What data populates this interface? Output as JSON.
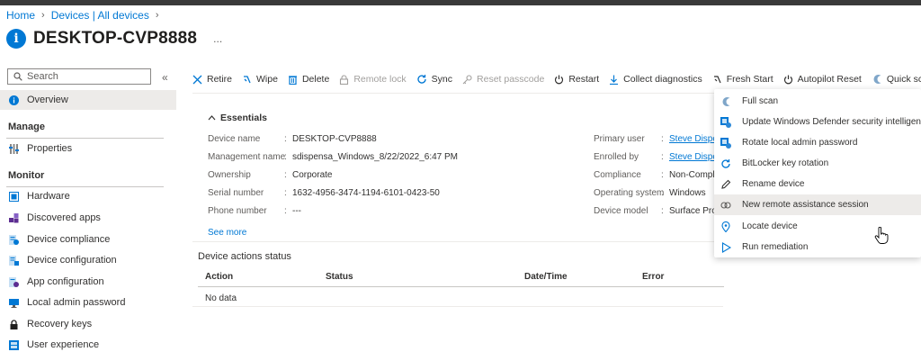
{
  "breadcrumb": {
    "home": "Home",
    "devices": "Devices | All devices"
  },
  "page": {
    "title": "DESKTOP-CVP8888",
    "more": "..."
  },
  "sidebar": {
    "search_placeholder": "Search",
    "collapse": "«",
    "overview": "Overview",
    "manage_heading": "Manage",
    "properties": "Properties",
    "monitor_heading": "Monitor",
    "monitor_items": [
      "Hardware",
      "Discovered apps",
      "Device compliance",
      "Device configuration",
      "App configuration",
      "Local admin password",
      "Recovery keys",
      "User experience"
    ]
  },
  "toolbar": {
    "retire": "Retire",
    "wipe": "Wipe",
    "delete": "Delete",
    "remote_lock": "Remote lock",
    "sync": "Sync",
    "reset_passcode": "Reset passcode",
    "restart": "Restart",
    "collect_diagnostics": "Collect diagnostics",
    "fresh_start": "Fresh Start",
    "autopilot_reset": "Autopilot Reset",
    "quick_scan": "Quick scan",
    "more": "..."
  },
  "essentials": {
    "heading": "Essentials",
    "left": [
      {
        "label": "Device name",
        "value": "DESKTOP-CVP8888"
      },
      {
        "label": "Management name",
        "value": "sdispensa_Windows_8/22/2022_6:47 PM"
      },
      {
        "label": "Ownership",
        "value": "Corporate"
      },
      {
        "label": "Serial number",
        "value": "1632-4956-3474-1194-6101-0423-50"
      },
      {
        "label": "Phone number",
        "value": "---"
      }
    ],
    "right": [
      {
        "label": "Primary user",
        "value": "Steve Dispen"
      },
      {
        "label": "Enrolled by",
        "value": "Steve Dispen"
      },
      {
        "label": "Compliance",
        "value": "Non-Compl"
      },
      {
        "label": "Operating system",
        "value": "Windows"
      },
      {
        "label": "Device model",
        "value": "Surface Pro"
      }
    ],
    "see_more": "See more"
  },
  "device_actions": {
    "title": "Device actions status",
    "columns": [
      "Action",
      "Status",
      "Date/Time",
      "Error"
    ],
    "empty": "No data"
  },
  "dropdown": {
    "items": [
      {
        "label": "Full scan",
        "icon": "defender-icon"
      },
      {
        "label": "Update Windows Defender security intelligence",
        "icon": "defender-update-icon"
      },
      {
        "label": "Rotate local admin password",
        "icon": "rotate-password-icon"
      },
      {
        "label": "BitLocker key rotation",
        "icon": "bitlocker-rotate-icon"
      },
      {
        "label": "Rename device",
        "icon": "pencil-icon"
      },
      {
        "label": "New remote assistance session",
        "icon": "remote-assist-icon"
      },
      {
        "label": "Locate device",
        "icon": "location-pin-icon"
      },
      {
        "label": "Run remediation",
        "icon": "play-icon"
      }
    ]
  },
  "colors": {
    "accent": "#0078d4",
    "text": "#323130",
    "muted": "#605e5c",
    "disabled": "#a19f9d"
  }
}
